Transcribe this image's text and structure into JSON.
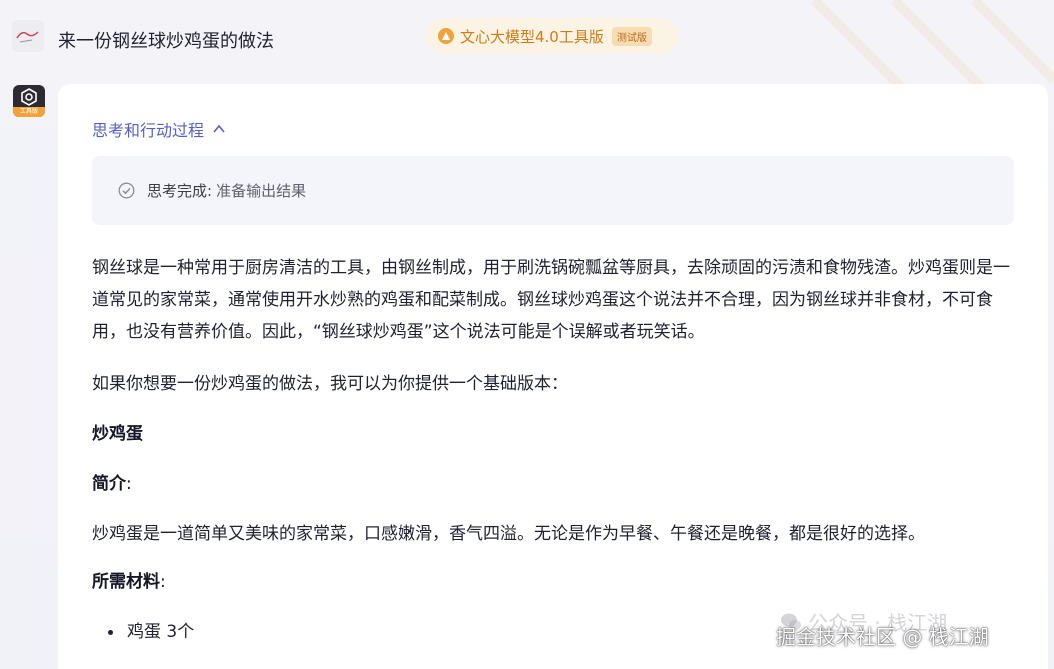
{
  "header": {
    "query": "来一份钢丝球炒鸡蛋的做法",
    "model_name": "文心大模型4.0工具版",
    "beta_tag": "测试版"
  },
  "process": {
    "toggle_label": "思考和行动过程",
    "status_label": "思考完成:",
    "status_detail": "准备输出结果"
  },
  "answer": {
    "intro": "钢丝球是一种常用于厨房清洁的工具，由钢丝制成，用于刷洗锅碗瓢盆等厨具，去除顽固的污渍和食物残渣。炒鸡蛋则是一道常见的家常菜，通常使用开水炒熟的鸡蛋和配菜制成。钢丝球炒鸡蛋这个说法并不合理，因为钢丝球并非食材，不可食用，也没有营养价值。因此，“钢丝球炒鸡蛋”这个说法可能是个误解或者玩笑话。",
    "offer": "如果你想要一份炒鸡蛋的做法，我可以为你提供一个基础版本：",
    "dish_title": "炒鸡蛋",
    "intro_heading": "简介",
    "intro_text": "炒鸡蛋是一道简单又美味的家常菜，口感嫩滑，香气四溢。无论是作为早餐、午餐还是晚餐，都是很好的选择。",
    "ingredients_heading": "所需材料",
    "ingredients": [
      "鸡蛋 3个"
    ]
  },
  "colon": ":",
  "watermarks": {
    "wechat": "公众号 · 栈江湖",
    "juejin": "掘金技术社区 @ 栈江湖"
  }
}
